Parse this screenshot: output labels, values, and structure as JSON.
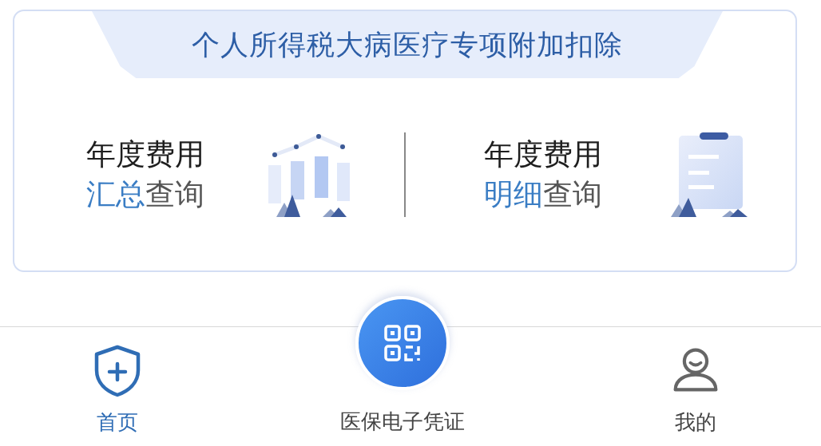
{
  "card": {
    "title": "个人所得税大病医疗专项附加扣除",
    "entries": [
      {
        "kind": "summary",
        "line1": "年度费用",
        "accent": "汇总",
        "rest": "查询"
      },
      {
        "kind": "detail",
        "line1": "年度费用",
        "accent": "明细",
        "rest": "查询"
      }
    ]
  },
  "tab_bar": [
    {
      "kind": "shield",
      "label": "首页",
      "selected": true
    },
    {
      "kind": "qr",
      "label": "医保电子凭证",
      "selected": false
    },
    {
      "kind": "person",
      "label": "我的",
      "selected": false
    }
  ]
}
